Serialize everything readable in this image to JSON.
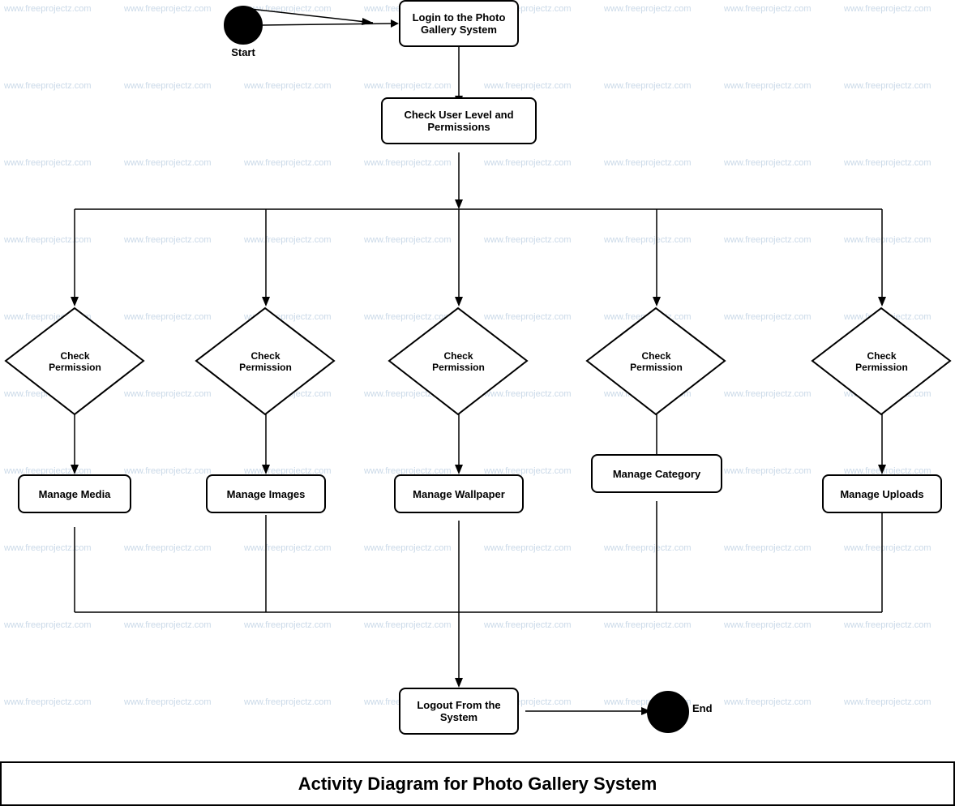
{
  "watermarks": {
    "text": "www.freeprojectz.com"
  },
  "diagram": {
    "title": "Activity Diagram for Photo Gallery System",
    "nodes": {
      "start_label": "Start",
      "end_label": "End",
      "login": "Login to the Photo\nGallery System",
      "check_user": "Check User Level and\nPermissions",
      "check_perm1": "Check\nPermission",
      "check_perm2": "Check\nPermission",
      "check_perm3": "Check\nPermission",
      "check_perm4": "Check\nPermission",
      "check_perm5": "Check\nPermission",
      "manage_media": "Manage Media",
      "manage_images": "Manage Images",
      "manage_wallpaper": "Manage Wallpaper",
      "manage_category": "Manage Category",
      "manage_uploads": "Manage Uploads",
      "logout": "Logout From the\nSystem"
    }
  }
}
